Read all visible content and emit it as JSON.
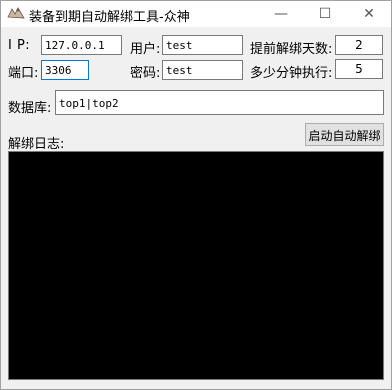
{
  "window": {
    "title": "装备到期自动解绑工具-众神",
    "controls": {
      "minimize": "—",
      "maximize": "☐",
      "close": "✕"
    }
  },
  "form": {
    "ip_label": "I  P:",
    "ip_value": "127.0.0.1",
    "user_label": "用户:",
    "user_value": "test",
    "advance_days_label": "提前解绑天数:",
    "advance_days_value": "2",
    "port_label": "端口:",
    "port_value": "3306",
    "password_label": "密码:",
    "password_value": "test",
    "interval_label": "多少分钟执行:",
    "interval_value": "5",
    "database_label": "数据库:",
    "database_value": "top1|top2"
  },
  "log": {
    "label": "解绑日志:",
    "start_button": "启动自动解绑"
  }
}
